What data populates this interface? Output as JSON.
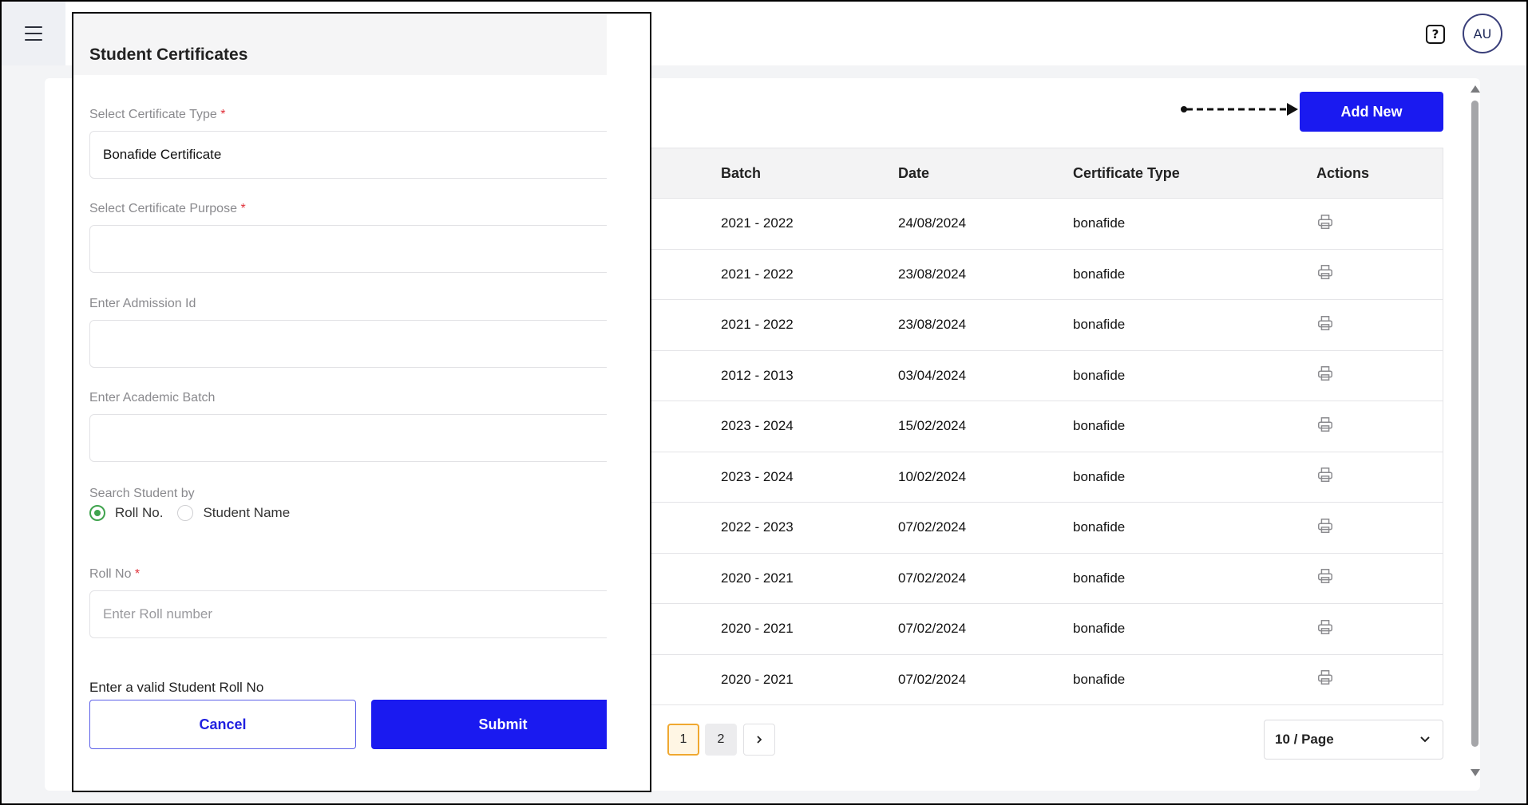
{
  "header": {
    "help_label": "?",
    "avatar_initials": "AU"
  },
  "toolbar": {
    "add_new_label": "Add New"
  },
  "table": {
    "columns": [
      "Batch",
      "Date",
      "Certificate Type",
      "Actions"
    ],
    "rows": [
      {
        "batch": "2021 - 2022",
        "date": "24/08/2024",
        "type": "bonafide"
      },
      {
        "batch": "2021 - 2022",
        "date": "23/08/2024",
        "type": "bonafide"
      },
      {
        "batch": "2021 - 2022",
        "date": "23/08/2024",
        "type": "bonafide"
      },
      {
        "batch": "2012 - 2013",
        "date": "03/04/2024",
        "type": "bonafide"
      },
      {
        "batch": "2023 - 2024",
        "date": "15/02/2024",
        "type": "bonafide"
      },
      {
        "batch": "2023 - 2024",
        "date": "10/02/2024",
        "type": "bonafide"
      },
      {
        "batch": "2022 - 2023",
        "date": "07/02/2024",
        "type": "bonafide"
      },
      {
        "batch": "2020 - 2021",
        "date": "07/02/2024",
        "type": "bonafide"
      },
      {
        "batch": "2020 - 2021",
        "date": "07/02/2024",
        "type": "bonafide"
      },
      {
        "batch": "2020 - 2021",
        "date": "07/02/2024",
        "type": "bonafide"
      }
    ],
    "action_icon": "print-icon"
  },
  "pagination": {
    "pages": [
      "1",
      "2"
    ],
    "current_page": "1",
    "page_size_label": "10 / Page"
  },
  "panel": {
    "title": "Student Certificates",
    "certificate_type_label": "Select Certificate Type",
    "certificate_type_value": "Bonafide Certificate",
    "certificate_purpose_label": "Select Certificate Purpose",
    "certificate_purpose_value": "",
    "admission_id_label": "Enter Admission Id",
    "admission_id_value": "",
    "academic_batch_label": "Enter Academic Batch",
    "academic_batch_value": "",
    "search_by_label": "Search Student by",
    "radio_roll": "Roll No.",
    "radio_name": "Student Name",
    "search_by_selected": "Roll No.",
    "roll_no_label": "Roll No",
    "roll_no_placeholder": "Enter Roll number",
    "required_mark": "*",
    "error_text": "Enter a valid Student Roll No",
    "cancel_label": "Cancel",
    "submit_label": "Submit"
  },
  "colors": {
    "primary": "#1a1af0",
    "radio_selected": "#3fa34d",
    "required": "#e0313a",
    "active_page_border": "#f0a830"
  }
}
